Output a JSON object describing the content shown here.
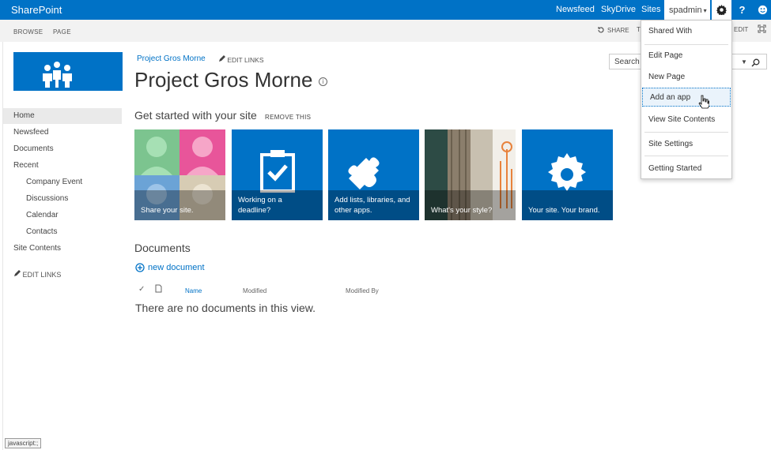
{
  "suitebar": {
    "brand": "SharePoint",
    "links": [
      "Newsfeed",
      "SkyDrive",
      "Sites"
    ],
    "user": "spadmin",
    "help": "?"
  },
  "ribbon": {
    "tabs": [
      "BROWSE",
      "PAGE"
    ],
    "share": "SHARE",
    "share_cut": "T",
    "edit": "EDIT"
  },
  "nav": {
    "items": [
      "Home",
      "Newsfeed",
      "Documents",
      "Recent",
      "Company Event",
      "Discussions",
      "Calendar",
      "Contacts",
      "Site Contents"
    ],
    "edit_links": "EDIT LINKS"
  },
  "header": {
    "breadcrumb": "Project Gros Morne",
    "edit_links": "EDIT LINKS",
    "title": "Project Gros Morne",
    "info_glyph": "i"
  },
  "search": {
    "placeholder": "Search"
  },
  "getstarted": {
    "heading": "Get started with your site",
    "remove": "REMOVE THIS",
    "tiles": [
      "Share your site.",
      "Working on a deadline?",
      "Add lists, libraries, and other apps.",
      "What's your style?",
      "Your site. Your brand."
    ]
  },
  "documents": {
    "title": "Documents",
    "new_doc": "new document",
    "columns": [
      "Name",
      "Modified",
      "Modified By"
    ],
    "empty": "There are no documents in this view."
  },
  "menu": {
    "items": [
      "Shared With",
      "Edit Page",
      "New Page",
      "Add an app",
      "View Site Contents",
      "Site Settings",
      "Getting Started"
    ]
  },
  "status": "javascript:;",
  "colors": {
    "accent": "#0072c6"
  }
}
